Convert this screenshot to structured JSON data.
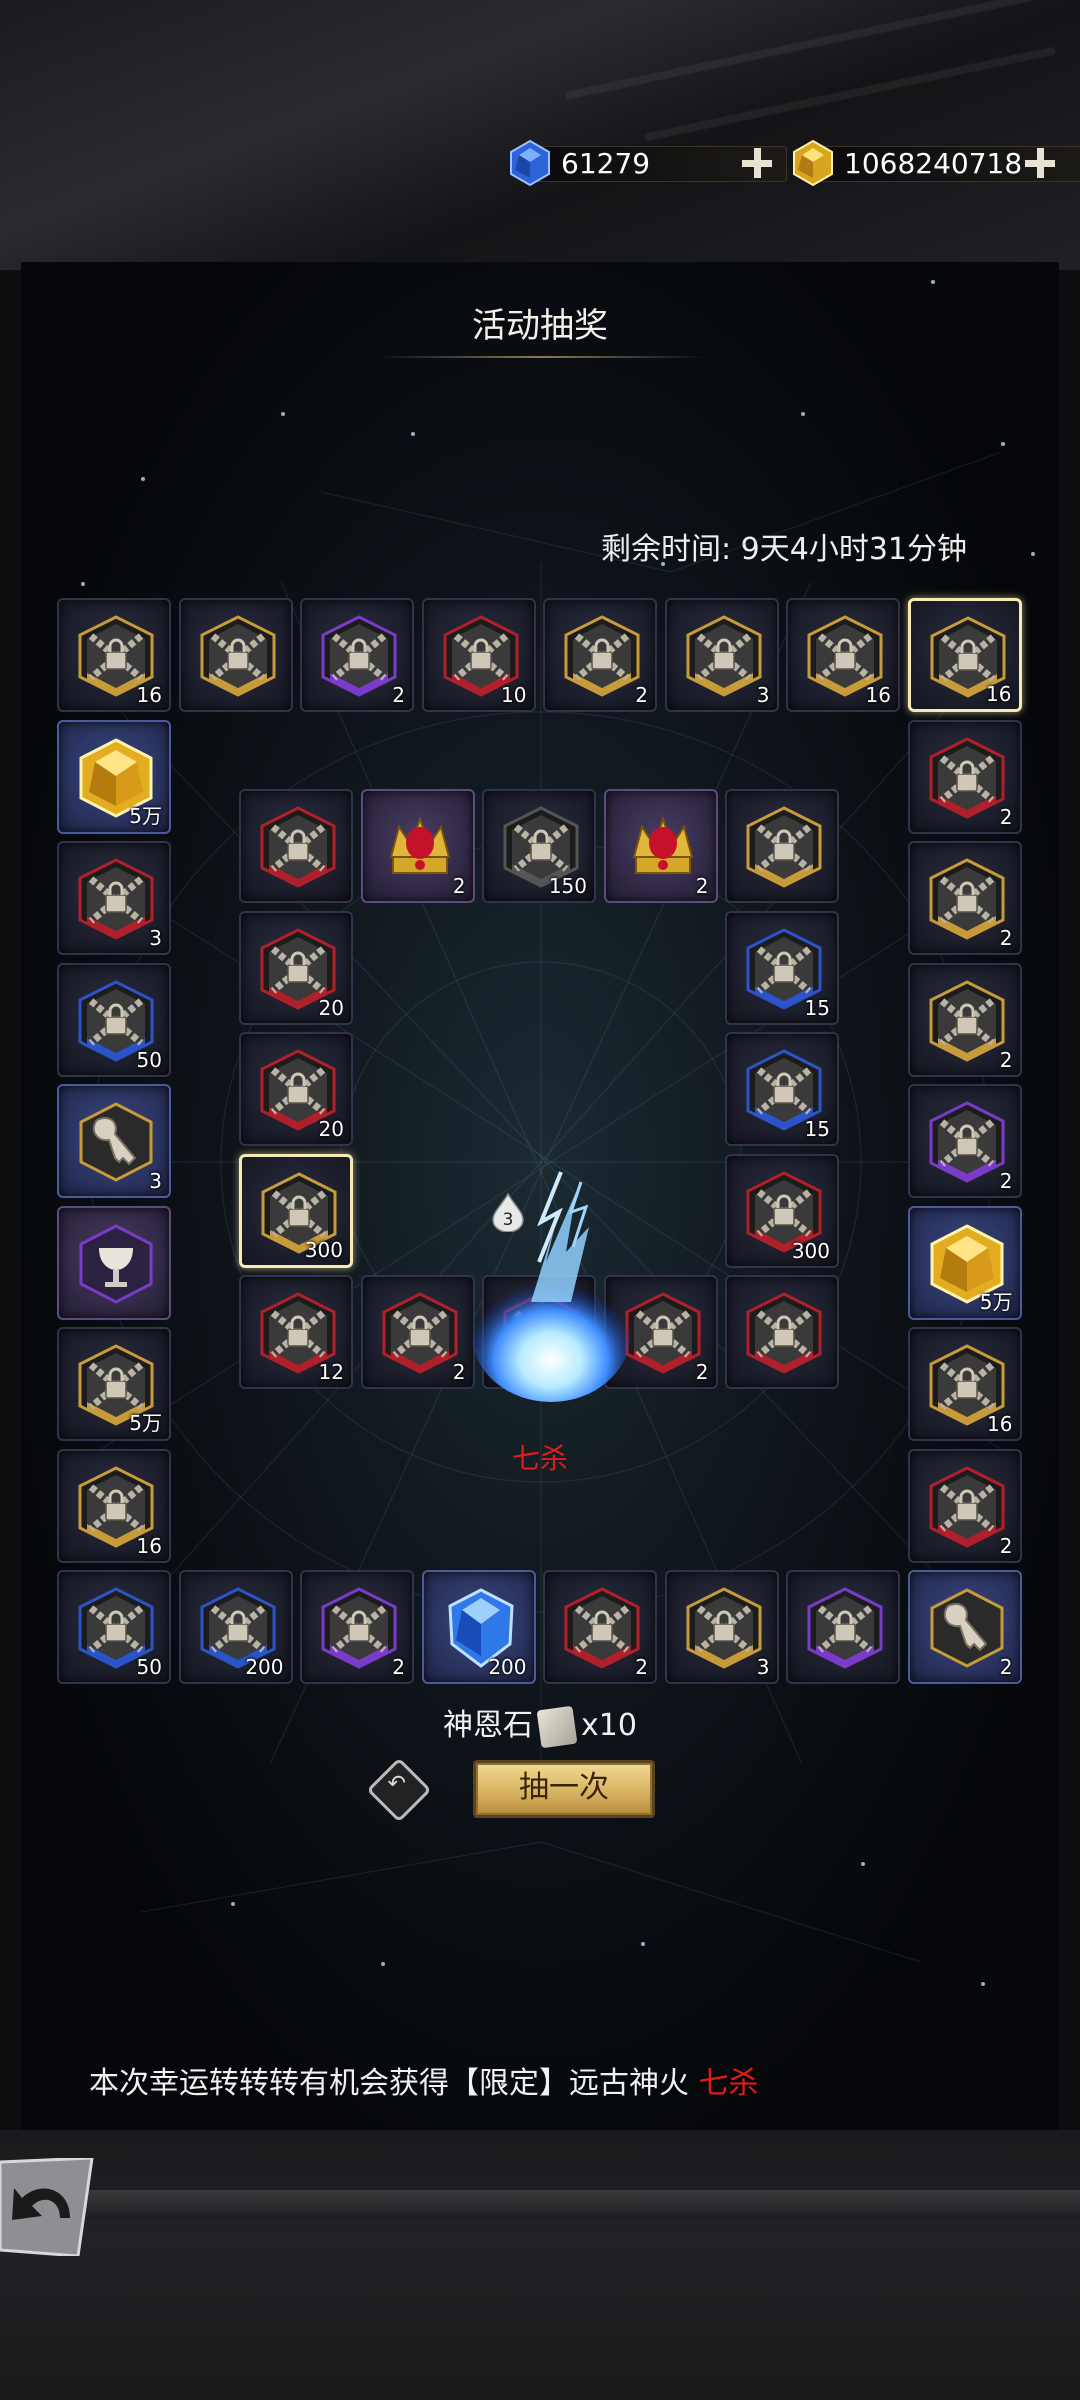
{
  "currency": {
    "gems": {
      "value": "61279",
      "icon": "blue-gem-icon"
    },
    "gold": {
      "value": "1068240718",
      "icon": "gold-gem-icon"
    }
  },
  "panel": {
    "title": "活动抽奖",
    "remaining_time": "剩余时间: 9天4小时31分钟",
    "center_item": "七杀",
    "cost_label": "神恩石",
    "cost_amount": "x10",
    "draw_button": "抽一次",
    "notice_prefix": "本次幸运转转转有机会获得【限定】远古神火",
    "notice_highlight": "七杀",
    "drop_badge": "3"
  },
  "outer_ring": {
    "top": [
      {
        "count": "16",
        "kind": "locked",
        "tint": "gold"
      },
      {
        "count": "",
        "kind": "locked",
        "tint": "gold"
      },
      {
        "count": "2",
        "kind": "locked",
        "tint": "purple"
      },
      {
        "count": "10",
        "kind": "locked",
        "tint": "red"
      },
      {
        "count": "2",
        "kind": "locked",
        "tint": "gold"
      },
      {
        "count": "3",
        "kind": "locked",
        "tint": "gold"
      },
      {
        "count": "16",
        "kind": "locked",
        "tint": "gold"
      },
      {
        "count": "16",
        "kind": "locked",
        "tint": "gold",
        "selected": true
      }
    ],
    "right": [
      {
        "count": "2",
        "kind": "locked",
        "tint": "red"
      },
      {
        "count": "2",
        "kind": "locked",
        "tint": "gold"
      },
      {
        "count": "2",
        "kind": "locked",
        "tint": "gold"
      },
      {
        "count": "2",
        "kind": "locked",
        "tint": "purple"
      },
      {
        "count": "5万",
        "kind": "gold-gem"
      },
      {
        "count": "16",
        "kind": "locked",
        "tint": "gold"
      },
      {
        "count": "2",
        "kind": "locked",
        "tint": "red"
      }
    ],
    "bottom": [
      {
        "count": "50",
        "kind": "locked",
        "tint": "blue"
      },
      {
        "count": "200",
        "kind": "locked",
        "tint": "blue"
      },
      {
        "count": "2",
        "kind": "locked",
        "tint": "purple"
      },
      {
        "count": "200",
        "kind": "blue-gem"
      },
      {
        "count": "2",
        "kind": "locked",
        "tint": "red"
      },
      {
        "count": "3",
        "kind": "locked",
        "tint": "gold"
      },
      {
        "count": "",
        "kind": "locked",
        "tint": "purple"
      },
      {
        "count": "2",
        "kind": "key"
      }
    ],
    "left": [
      {
        "count": "5万",
        "kind": "gold-gem"
      },
      {
        "count": "3",
        "kind": "locked",
        "tint": "red"
      },
      {
        "count": "50",
        "kind": "locked",
        "tint": "blue"
      },
      {
        "count": "3",
        "kind": "key"
      },
      {
        "count": "",
        "kind": "chalice"
      },
      {
        "count": "5万",
        "kind": "locked",
        "tint": "gold"
      },
      {
        "count": "16",
        "kind": "locked",
        "tint": "gold"
      }
    ]
  },
  "inner_ring": {
    "top": [
      {
        "count": "",
        "kind": "locked",
        "tint": "red"
      },
      {
        "count": "2",
        "kind": "crown"
      },
      {
        "count": "150",
        "kind": "locked",
        "tint": "gray"
      },
      {
        "count": "2",
        "kind": "crown"
      },
      {
        "count": "",
        "kind": "locked",
        "tint": "gold"
      }
    ],
    "right": [
      {
        "count": "15",
        "kind": "locked",
        "tint": "blue"
      },
      {
        "count": "15",
        "kind": "locked",
        "tint": "blue"
      },
      {
        "count": "300",
        "kind": "locked",
        "tint": "red"
      }
    ],
    "bottom": [
      {
        "count": "12",
        "kind": "locked",
        "tint": "red"
      },
      {
        "count": "2",
        "kind": "locked",
        "tint": "red"
      },
      {
        "count": "2",
        "kind": "locked",
        "tint": "red"
      },
      {
        "count": "2",
        "kind": "locked",
        "tint": "red"
      },
      {
        "count": "",
        "kind": "locked",
        "tint": "red"
      }
    ],
    "left": [
      {
        "count": "20",
        "kind": "locked",
        "tint": "red"
      },
      {
        "count": "20",
        "kind": "locked",
        "tint": "red"
      },
      {
        "count": "300",
        "kind": "locked",
        "tint": "gold",
        "selected": true
      }
    ]
  },
  "colors": {
    "accent_red": "#e01b1b",
    "select_border": "#f6e9b3",
    "tint_gold": "#c79a3a",
    "tint_red": "#b0202a",
    "tint_blue": "#2a54c8",
    "tint_purple": "#7a3cc8",
    "tint_gray": "#555555"
  }
}
